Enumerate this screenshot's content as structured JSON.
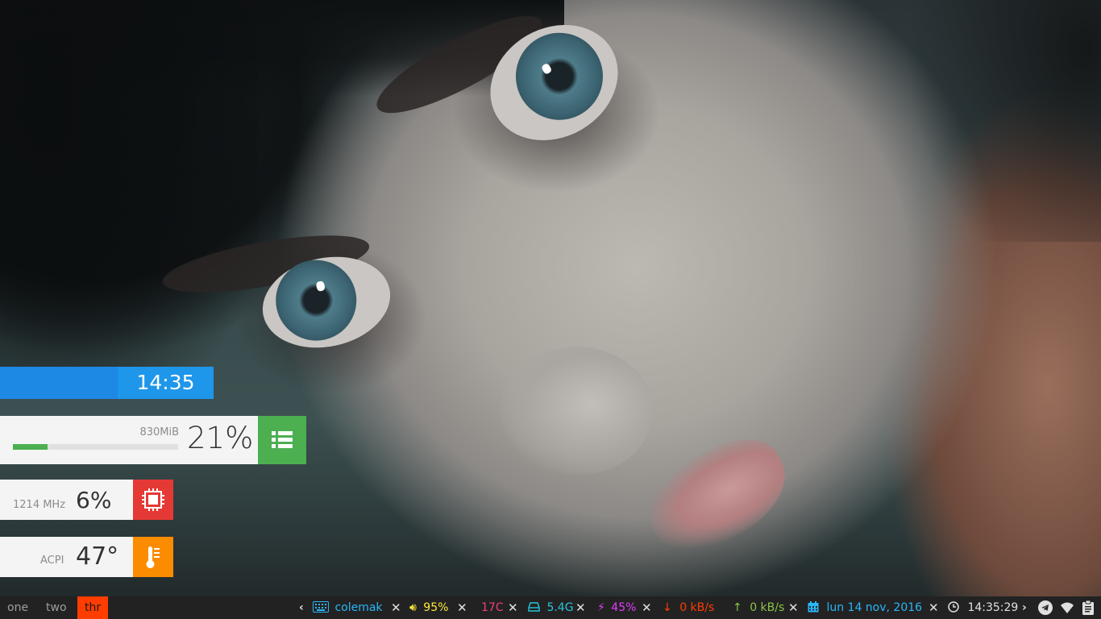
{
  "widgets": {
    "clock": {
      "time": "14:35"
    },
    "memory": {
      "used": "830MiB",
      "percent_label": "21%",
      "percent_value": 0.21,
      "icon": "list-icon",
      "accent": "#4caf50"
    },
    "cpu": {
      "frequency": "1214 MHz",
      "percent_label": "6%",
      "icon": "chip-icon",
      "accent": "#e53935"
    },
    "temperature": {
      "source": "ACPI",
      "value_label": "47°",
      "icon": "thermometer-icon",
      "accent": "#fb8c00"
    }
  },
  "bar": {
    "workspaces": [
      {
        "label": "one",
        "active": false
      },
      {
        "label": "two",
        "active": false
      },
      {
        "label": "thr",
        "active": true
      }
    ],
    "keyboard": {
      "icon": "keyboard-icon",
      "label": "colemak",
      "color": "#29b6f6"
    },
    "volume": {
      "icon": "speaker-icon",
      "label": "95%",
      "color": "#ffeb3b"
    },
    "temp": {
      "label": "17C",
      "color": "#ec407a"
    },
    "disk": {
      "icon": "disk-icon",
      "label": "5.4G",
      "color": "#26c6da"
    },
    "battery": {
      "icon": "bolt-icon",
      "label": "45%",
      "color": "#e040fb"
    },
    "net_down": {
      "icon": "arrow-down-icon",
      "label": "0 kB/s",
      "color": "#ff3d00"
    },
    "net_up": {
      "icon": "arrow-up-icon",
      "label": "0 kB/s",
      "color": "#8bc34a"
    },
    "date": {
      "icon": "calendar-icon",
      "label": "lun 14 nov, 2016",
      "color": "#29b6f6"
    },
    "clock": {
      "icon": "clock-icon",
      "label": "14:35:29",
      "color": "#e0e0e0"
    },
    "tray": [
      "telegram-icon",
      "wifi-icon",
      "clipboard-icon"
    ]
  }
}
